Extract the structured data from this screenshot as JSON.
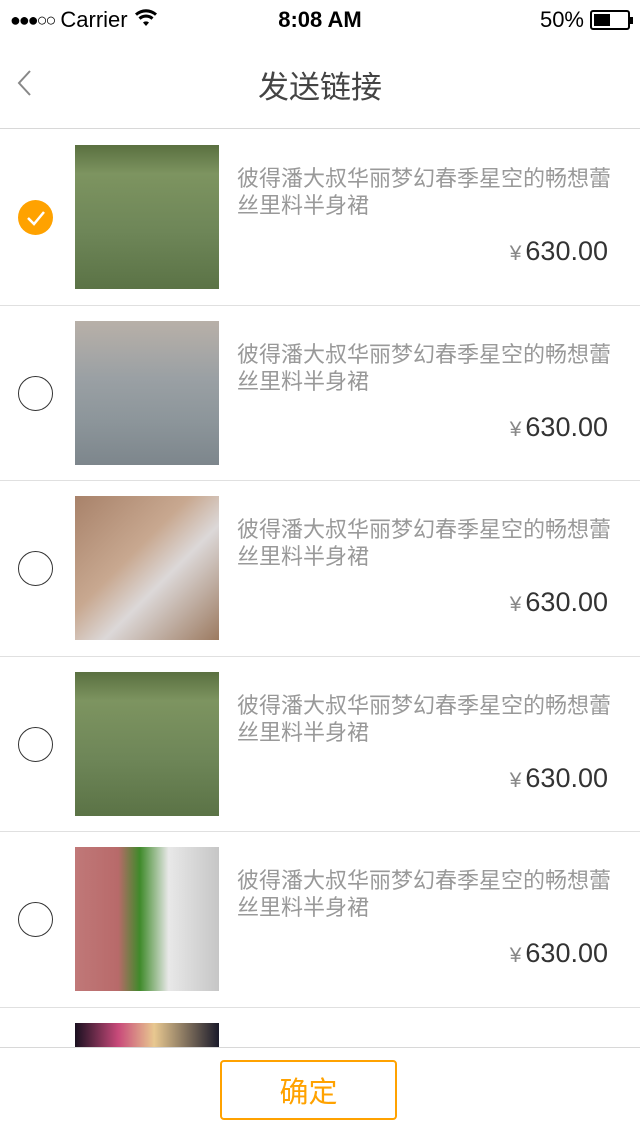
{
  "status_bar": {
    "signal": "●●●○○",
    "carrier": "Carrier",
    "time": "8:08 AM",
    "battery": "50%",
    "battery_level": 0.5
  },
  "nav": {
    "title": "发送链接",
    "back_icon": "chevron-left-icon"
  },
  "accent": "#ffa200",
  "items": [
    {
      "title": "彼得潘大叔华丽梦幻春季星空的畅想蕾丝里料半身裙",
      "currency": "¥",
      "price": "630.00",
      "selected": true,
      "thumb": "linear-gradient(180deg,#5a7040 0%,#7d9460 20%,#6e8658 60%,#5b7346 100%)"
    },
    {
      "title": "彼得潘大叔华丽梦幻春季星空的畅想蕾丝里料半身裙",
      "currency": "¥",
      "price": "630.00",
      "selected": false,
      "thumb": "linear-gradient(180deg,#b8b0a8 0%,#9aa0a4 40%,#8c959a 70%,#7d868c 100%)"
    },
    {
      "title": "彼得潘大叔华丽梦幻春季星空的畅想蕾丝里料半身裙",
      "currency": "¥",
      "price": "630.00",
      "selected": false,
      "thumb": "linear-gradient(135deg,#a8826a 0%,#c8a890 40%,#dcd8d8 60%,#9c7a60 100%)"
    },
    {
      "title": "彼得潘大叔华丽梦幻春季星空的畅想蕾丝里料半身裙",
      "currency": "¥",
      "price": "630.00",
      "selected": false,
      "thumb": "linear-gradient(180deg,#5a7040 0%,#7d9460 20%,#6e8658 60%,#5b7346 100%)"
    },
    {
      "title": "彼得潘大叔华丽梦幻春季星空的畅想蕾丝里料半身裙",
      "currency": "¥",
      "price": "630.00",
      "selected": false,
      "thumb": "linear-gradient(90deg,#c07878 0%,#b86a6a 30%,#3f8a2a 45%,#e8e8e8 65%,#c6c6c6 100%)"
    },
    {
      "title": "",
      "currency": "",
      "price": "",
      "selected": false,
      "thumb": "linear-gradient(90deg,#1a1020 0%,#c84a7a 30%,#e8c890 55%,#1a1a2a 100%)"
    }
  ],
  "footer": {
    "confirm_label": "确定"
  }
}
